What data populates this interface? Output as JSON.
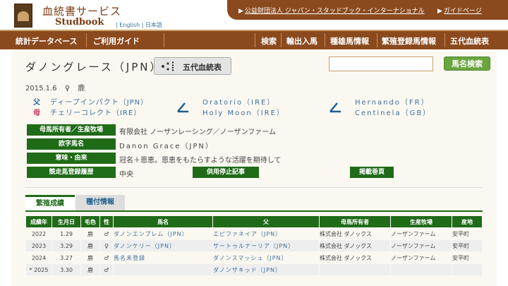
{
  "header": {
    "title": "血統書サービス",
    "subtitle": "Studbook",
    "lang_sep": "|",
    "lang_en": "English",
    "lang_ja": "日本語",
    "top_links": [
      "公益財団法人 ジャパン・スタッドブック・インターナショナル",
      "ガイドページ"
    ]
  },
  "nav": {
    "left": [
      "統計データベース",
      "ご利用ガイド"
    ],
    "right": [
      "検索",
      "輸出入馬",
      "種雄馬情報",
      "繁殖登録馬情報",
      "五代血統表"
    ]
  },
  "horse": {
    "name": "ダノングレース（JPN）",
    "pedigree_button": "五代血統表",
    "birth": "2015.1.6",
    "sex": "♀",
    "color": "鹿"
  },
  "search": {
    "value": "",
    "button": "馬名検索"
  },
  "pedigree": {
    "sire_label": "父",
    "dam_label": "母",
    "sire": "ディープインパクト（JPN）",
    "dam": "チェリーコレクト（IRE）",
    "damsire": "Oratorio（IRE）",
    "damdam": "Holy Moon（IRE）",
    "damsire_sire": "Hernando（FR）",
    "damsire_dam": "Centinela（GB）"
  },
  "profile": {
    "rows": [
      {
        "label": "母馬所有者／生産牧場",
        "value": "有限会社 ノーザンレーシング／ノーザンファーム"
      },
      {
        "label": "欧字馬名",
        "value": "Danon Grace（JPN）"
      },
      {
        "label": "意味・由来",
        "value": "冠名＋恩恵。恩恵をもたらすような活躍を期待して"
      },
      {
        "label": "競走馬登録履歴",
        "value": "中央"
      }
    ],
    "btn_suspend": "供用停止記事",
    "btn_pages": "掲載巻頁"
  },
  "tabs": [
    "繁殖成績",
    "種付情報"
  ],
  "table": {
    "headers": [
      "成績年",
      "生月日",
      "毛色",
      "性",
      "馬名",
      "父",
      "母馬所有者",
      "生産牧場",
      "産地"
    ],
    "rows": [
      [
        "2022",
        "1.29",
        "鹿",
        "♂",
        "ダノンエンブレム（JPN）",
        "エピファネイア（JPN）",
        "株式会社 ダノックス",
        "ノーザンファーム",
        "安平町"
      ],
      [
        "2023",
        "3.29",
        "鹿",
        "♀",
        "ダノンケリー（JPN）",
        "サートゥルナーリア（JPN）",
        "株式会社 ダノックス",
        "ノーザンファーム",
        "安平町"
      ],
      [
        "2024",
        "3.27",
        "鹿",
        "♂",
        "馬名未登録",
        "ダノンスマッシュ（JPN）",
        "株式会社 ダノックス",
        "ノーザンファーム",
        "安平町"
      ],
      [
        "* 2025",
        "3.30",
        "鹿",
        "♂",
        "",
        "ダノンザキッド（JPN）",
        "",
        "",
        ""
      ]
    ]
  },
  "colors": {
    "brown": "#8b4a1e",
    "green": "#1f6b18",
    "link": "#3b6e9e"
  }
}
